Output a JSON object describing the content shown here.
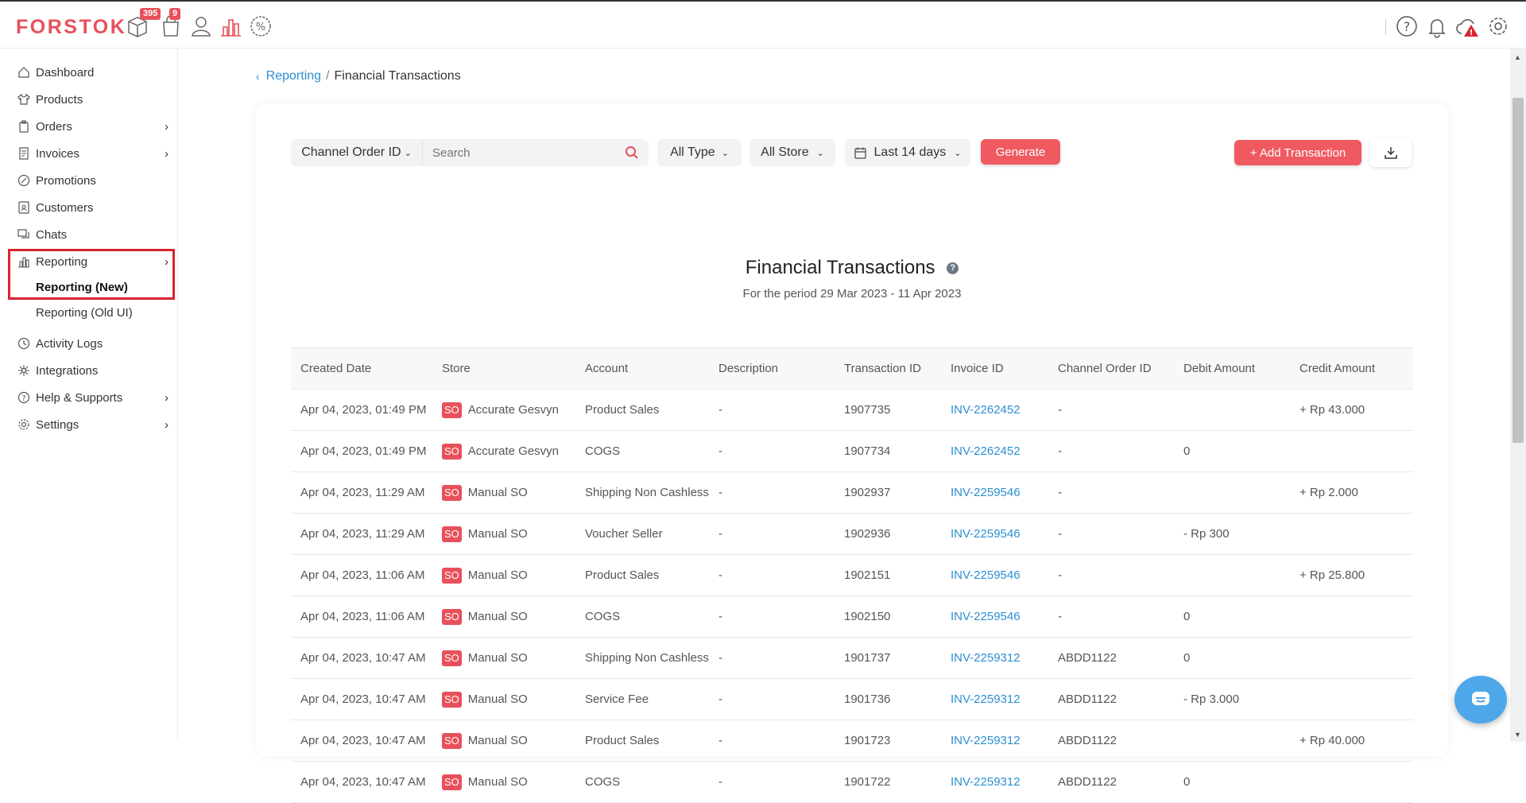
{
  "app": {
    "logo": "FORSTOK"
  },
  "topbar": {
    "badges": {
      "products_count": "395",
      "orders_count": "9"
    },
    "icons": [
      "package-icon",
      "bag-icon",
      "user-icon",
      "chart-icon",
      "discount-icon",
      "help-icon",
      "bell-icon",
      "cloud-alert-icon",
      "settings-icon"
    ]
  },
  "sidebar": {
    "items": [
      {
        "label": "Dashboard",
        "icon": "home-icon"
      },
      {
        "label": "Products",
        "icon": "shirt-icon"
      },
      {
        "label": "Orders",
        "icon": "clipboard-icon"
      },
      {
        "label": "Invoices",
        "icon": "document-icon"
      },
      {
        "label": "Promotions",
        "icon": "discount-icon"
      },
      {
        "label": "Customers",
        "icon": "contact-icon"
      },
      {
        "label": "Chats",
        "icon": "chat-icon"
      },
      {
        "label": "Reporting",
        "icon": "bar-chart-icon"
      },
      {
        "label": "Activity Logs",
        "icon": "history-icon"
      },
      {
        "label": "Integrations",
        "icon": "integrations-icon"
      },
      {
        "label": "Help & Supports",
        "icon": "help-icon"
      },
      {
        "label": "Settings",
        "icon": "gear-icon"
      }
    ],
    "sub": {
      "reporting_new": "Reporting (New)",
      "reporting_old": "Reporting (Old UI)"
    }
  },
  "breadcrumb": {
    "parent": "Reporting",
    "separator": "/",
    "current": "Financial Transactions"
  },
  "filters": {
    "search_by": "Channel Order ID",
    "search_placeholder": "Search",
    "type": "All Type",
    "store": "All Store",
    "date": "Last 14 days",
    "generate": "Generate",
    "add_transaction": "+ Add Transaction"
  },
  "report": {
    "title": "Financial Transactions",
    "period": "For the period 29 Mar 2023 - 11 Apr 2023"
  },
  "table": {
    "headers": [
      "Created Date",
      "Store",
      "Account",
      "Description",
      "Transaction ID",
      "Invoice ID",
      "Channel Order ID",
      "Debit Amount",
      "Credit Amount"
    ],
    "so_badge": "SO",
    "rows": [
      {
        "date": "Apr 04, 2023, 01:49 PM",
        "store": "Accurate Gesvyn",
        "account": "Product Sales",
        "desc": "-",
        "txn": "1907735",
        "invoice": "INV-2262452",
        "channel": "-",
        "debit": "",
        "credit": "+ Rp 43.000"
      },
      {
        "date": "Apr 04, 2023, 01:49 PM",
        "store": "Accurate Gesvyn",
        "account": "COGS",
        "desc": "-",
        "txn": "1907734",
        "invoice": "INV-2262452",
        "channel": "-",
        "debit": "0",
        "credit": ""
      },
      {
        "date": "Apr 04, 2023, 11:29 AM",
        "store": "Manual SO",
        "account": "Shipping Non Cashless",
        "desc": "-",
        "txn": "1902937",
        "invoice": "INV-2259546",
        "channel": "-",
        "debit": "",
        "credit": "+ Rp 2.000"
      },
      {
        "date": "Apr 04, 2023, 11:29 AM",
        "store": "Manual SO",
        "account": "Voucher Seller",
        "desc": "-",
        "txn": "1902936",
        "invoice": "INV-2259546",
        "channel": "-",
        "debit": "- Rp 300",
        "credit": ""
      },
      {
        "date": "Apr 04, 2023, 11:06 AM",
        "store": "Manual SO",
        "account": "Product Sales",
        "desc": "-",
        "txn": "1902151",
        "invoice": "INV-2259546",
        "channel": "-",
        "debit": "",
        "credit": "+ Rp 25.800"
      },
      {
        "date": "Apr 04, 2023, 11:06 AM",
        "store": "Manual SO",
        "account": "COGS",
        "desc": "-",
        "txn": "1902150",
        "invoice": "INV-2259546",
        "channel": "-",
        "debit": "0",
        "credit": ""
      },
      {
        "date": "Apr 04, 2023, 10:47 AM",
        "store": "Manual SO",
        "account": "Shipping Non Cashless",
        "desc": "-",
        "txn": "1901737",
        "invoice": "INV-2259312",
        "channel": "ABDD1122",
        "debit": "0",
        "credit": ""
      },
      {
        "date": "Apr 04, 2023, 10:47 AM",
        "store": "Manual SO",
        "account": "Service Fee",
        "desc": "-",
        "txn": "1901736",
        "invoice": "INV-2259312",
        "channel": "ABDD1122",
        "debit": "- Rp 3.000",
        "credit": ""
      },
      {
        "date": "Apr 04, 2023, 10:47 AM",
        "store": "Manual SO",
        "account": "Product Sales",
        "desc": "-",
        "txn": "1901723",
        "invoice": "INV-2259312",
        "channel": "ABDD1122",
        "debit": "",
        "credit": "+ Rp 40.000"
      },
      {
        "date": "Apr 04, 2023, 10:47 AM",
        "store": "Manual SO",
        "account": "COGS",
        "desc": "-",
        "txn": "1901722",
        "invoice": "INV-2259312",
        "channel": "ABDD1122",
        "debit": "0",
        "credit": ""
      }
    ]
  },
  "colors": {
    "brand": "#e8505b",
    "link": "#2b8fd1",
    "highlight_box": "#d9242f"
  }
}
